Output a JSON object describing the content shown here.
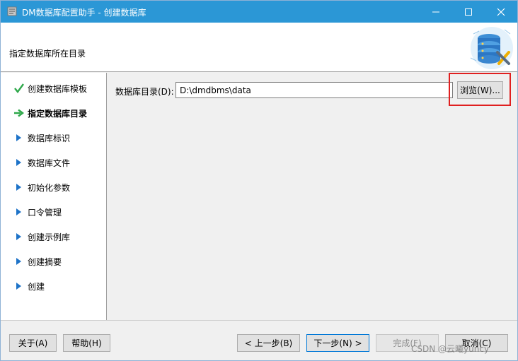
{
  "window": {
    "title": "DM数据库配置助手 - 创建数据库",
    "controls": {
      "minimize": "minimize-icon",
      "maximize": "maximize-icon",
      "close": "close-icon"
    }
  },
  "header": {
    "subtitle": "指定数据库所在目录",
    "logo_icon": "database-tools-icon"
  },
  "steps": [
    {
      "label": "创建数据库模板",
      "state": "done",
      "icon": "check-icon"
    },
    {
      "label": "指定数据库目录",
      "state": "current",
      "icon": "arrow-right-icon"
    },
    {
      "label": "数据库标识",
      "state": "pending",
      "icon": "triangle-right-icon"
    },
    {
      "label": "数据库文件",
      "state": "pending",
      "icon": "triangle-right-icon"
    },
    {
      "label": "初始化参数",
      "state": "pending",
      "icon": "triangle-right-icon"
    },
    {
      "label": "口令管理",
      "state": "pending",
      "icon": "triangle-right-icon"
    },
    {
      "label": "创建示例库",
      "state": "pending",
      "icon": "triangle-right-icon"
    },
    {
      "label": "创建摘要",
      "state": "pending",
      "icon": "triangle-right-icon"
    },
    {
      "label": "创建",
      "state": "pending",
      "icon": "triangle-right-icon"
    }
  ],
  "content": {
    "dir_label": "数据库目录(D):",
    "dir_value": "D:\\dmdbms\\data",
    "browse_label": "浏览(W)..."
  },
  "footer": {
    "about": "关于(A)",
    "help": "帮助(H)",
    "prev": "< 上一步(B)",
    "next": "下一步(N) >",
    "finish": "完成(F)",
    "cancel": "取消(C)"
  },
  "watermark": "CSDN @云曦yuncy",
  "colors": {
    "titlebar": "#2b97d6",
    "check": "#2ea84a",
    "arrow": "#2ea84a",
    "triangle": "#1e73c8",
    "highlight": "#e02020"
  }
}
